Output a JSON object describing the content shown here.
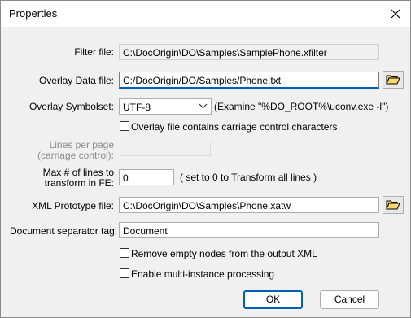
{
  "window": {
    "title": "Properties"
  },
  "filter_file": {
    "label": "Filter file:",
    "value": "C:\\DocOrigin\\DO\\Samples\\SamplePhone.xfilter"
  },
  "overlay_data_file": {
    "label": "Overlay Data file:",
    "value": "C:/DocOrigin/DO/Samples/Phone.txt"
  },
  "overlay_symbolset": {
    "label": "Overlay Symbolset:",
    "value": "UTF-8",
    "hint": "(Examine \"%DO_ROOT%\\uconv.exe -l\")"
  },
  "carriage_control": {
    "label": "Overlay file contains carriage control characters",
    "checked": false
  },
  "lines_per_page": {
    "label_line1": "Lines per page",
    "label_line2": "(carriage control):",
    "value": ""
  },
  "max_lines": {
    "label_line1": "Max # of lines to",
    "label_line2": "transform in FE:",
    "value": "0",
    "hint": "( set to 0 to Transform all lines )"
  },
  "xml_prototype": {
    "label": "XML Prototype file:",
    "value": "C:\\DocOrigin\\DO\\Samples\\Phone.xatw"
  },
  "doc_separator": {
    "label": "Document separator tag:",
    "value": "Document"
  },
  "remove_empty": {
    "label": "Remove empty nodes from the output XML",
    "checked": false
  },
  "multi_instance": {
    "label": "Enable multi-instance processing",
    "checked": false
  },
  "buttons": {
    "ok": "OK",
    "cancel": "Cancel"
  },
  "icons": {
    "close": "close-icon",
    "browse": "folder-open-icon",
    "dropdown": "chevron-down-icon"
  }
}
